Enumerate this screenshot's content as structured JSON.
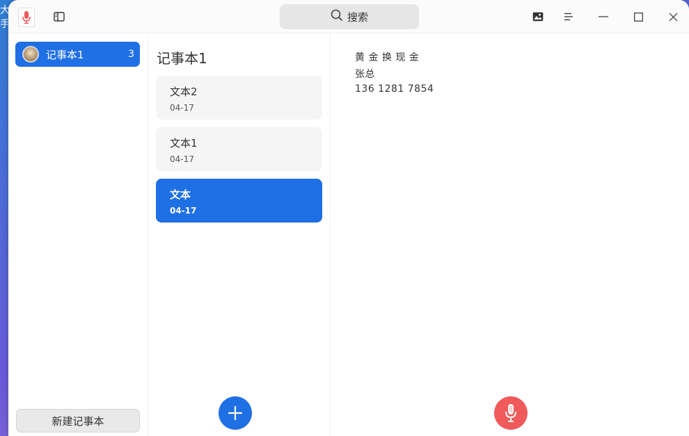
{
  "desktop": {
    "fragment_1": "大a",
    "fragment_2": "手I"
  },
  "titlebar": {
    "search_label": "搜索",
    "icons": [
      "app-recorder-icon",
      "sidebar-toggle-icon",
      "search-icon",
      "image-icon",
      "menu-icon",
      "minimize-icon",
      "maximize-icon",
      "close-icon"
    ]
  },
  "sidebar": {
    "notebooks": [
      {
        "label": "记事本1",
        "count": "3"
      }
    ],
    "new_notebook_label": "新建记事本"
  },
  "notes": {
    "title": "记事本1",
    "items": [
      {
        "title": "文本2",
        "date": "04-17"
      },
      {
        "title": "文本1",
        "date": "04-17"
      },
      {
        "title": "文本",
        "date": "04-17"
      }
    ]
  },
  "editor": {
    "lines": [
      "黄 金 换 现 金",
      "张总",
      "136 1281 7854"
    ]
  },
  "colors": {
    "accent": "#1f6fe5",
    "record": "#f05a5a"
  }
}
